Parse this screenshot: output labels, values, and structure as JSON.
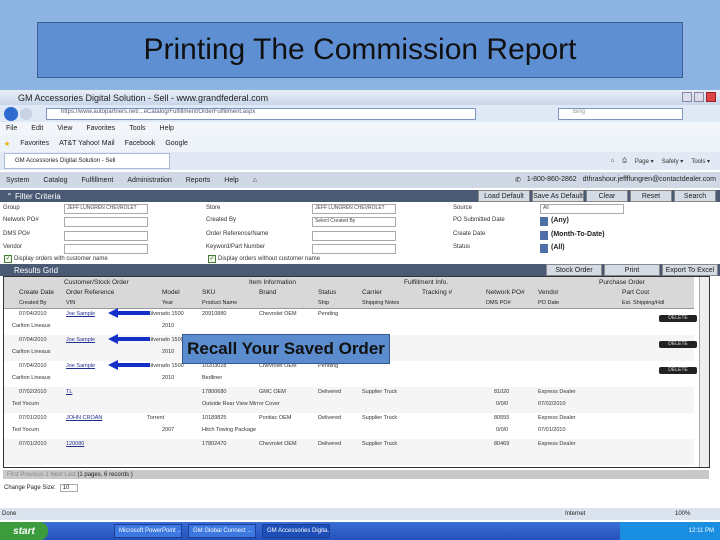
{
  "slide_title": "Printing The Commission Report",
  "callout": "Recall Your Saved Order",
  "browser": {
    "window_title": "GM Accessories Digital Solution - Sell - www.grandfederal.com",
    "url": "https://www.autopartners.net/...eCatalog/Fulfillment/OrderFulfillment.aspx",
    "search_placeholder": "Bing",
    "menu": [
      "File",
      "Edit",
      "View",
      "Favorites",
      "Tools",
      "Help"
    ],
    "favorites": [
      "Favorites",
      "AT&T Yahoo! Mail",
      "Facebook",
      "Google"
    ],
    "tab": "GM Accessories Digital Solution - Sell",
    "tools": [
      "Page ▾",
      "Safety ▾",
      "Tools ▾"
    ],
    "status": "Done",
    "zone": "Internet",
    "zoom": "100%"
  },
  "app": {
    "nav": [
      "System",
      "Catalog",
      "Fulfillment",
      "Administration",
      "Reports",
      "Help"
    ],
    "phone": "1-800-860-2862",
    "email": "dthrashour.jeffflungren@contactdealer.com",
    "filter": {
      "title": "Filter Criteria",
      "buttons": [
        "Load Default",
        "Save As Default",
        "Clear",
        "Reset",
        "Search"
      ],
      "group_label": "Group",
      "group_value": "JEFF LUNGREN CHEVROLET",
      "network_po_label": "Network PO#",
      "dms_po_label": "DMS PO#",
      "vendor_label": "Vendor",
      "store_label": "Store",
      "store_value": "JEFF LUNGREN CHEVROLET",
      "created_by_label": "Created By",
      "created_by_value": "Select Created By",
      "order_ref_label": "Order Reference/Name",
      "keyword_label": "Keyword/Part Number",
      "source_label": "Source",
      "source_value": "All",
      "po_date_label": "PO Submitted Date",
      "po_date_value": "(Any)",
      "create_date_label": "Create Date",
      "create_date_value": "(Month-To-Date)",
      "status_label": "Status",
      "status_value": "(All)",
      "chk_with": "Display orders with customer name",
      "chk_without": "Display orders without customer name"
    },
    "results": {
      "title": "Results Grid",
      "buttons": [
        "Stock Order",
        "Print",
        "Export To Excel"
      ],
      "groups": [
        "Customer/Stock Order",
        "Item Information",
        "Fulfillment Info.",
        "Purchase Order"
      ],
      "headers1": [
        "Create Date",
        "Order Reference",
        "Model",
        "SKU",
        "Brand",
        "Status",
        "Carrier",
        "Tracking #",
        "Network PO#",
        "Vendor",
        "Part Cost"
      ],
      "headers2": [
        "Created By",
        "VIN",
        "Year",
        "Product Name",
        "",
        "Ship",
        "Shipping Notes",
        "",
        "DMS PO#",
        "PO Date",
        "Est. Shipping/Hdl"
      ],
      "delete_label": "DELETE",
      "rows": [
        {
          "date": "07/04/2010",
          "by": "Carlton Lineaus",
          "ref": "Joe Sample",
          "model": "Silverado 1500",
          "year": "2010",
          "sku": "20910880",
          "product": "",
          "brand": "Chevrolet OEM",
          "status": "Pending",
          "carrier": "",
          "network_po": "",
          "dms_po": "",
          "vendor": "",
          "po_date": "",
          "deletable": true
        },
        {
          "date": "07/04/2010",
          "by": "Carlton Lineaus",
          "ref": "Joe Sample",
          "model": "Silverado 1500",
          "year": "2010",
          "sku": "",
          "product": "",
          "brand": "",
          "status": "",
          "carrier": "",
          "network_po": "",
          "dms_po": "",
          "vendor": "",
          "po_date": "",
          "deletable": true
        },
        {
          "date": "07/04/2010",
          "by": "Carlton Lineaus",
          "ref": "Joe Sample",
          "model": "Silverado 1500",
          "year": "2010",
          "sku": "10203028",
          "product": "Bedliner",
          "brand": "Chevrolet OEM",
          "status": "Pending",
          "carrier": "",
          "network_po": "",
          "dms_po": "",
          "vendor": "",
          "po_date": "",
          "deletable": true
        },
        {
          "date": "07/02/2010",
          "by": "Ted Yocum",
          "ref": "TL",
          "model": "",
          "year": "",
          "sku": "17800680",
          "product": "Outside Rear View Mirror Cover",
          "brand": "GMC OEM",
          "status": "Delivered",
          "carrier": "Supplier Truck",
          "network_po": "81020",
          "dms_po": "0/0/0",
          "vendor": "Express Dealer",
          "po_date": "07/02/2010",
          "deletable": false
        },
        {
          "date": "07/01/2010",
          "by": "Ted Yocum",
          "ref": "JOHN CROAN",
          "model": "Torrent",
          "year": "2007",
          "sku": "10189825",
          "product": "Hitch Towing Package",
          "brand": "Pontiac OEM",
          "status": "Delivered",
          "carrier": "Supplier Truck",
          "network_po": "80555",
          "dms_po": "0/0/0",
          "vendor": "Express Dealer",
          "po_date": "07/01/2010",
          "deletable": false
        },
        {
          "date": "07/01/2010",
          "by": "",
          "ref": "120080",
          "model": "",
          "year": "",
          "sku": "17802470",
          "product": "",
          "brand": "Chevrolet OEM",
          "status": "Delivered",
          "carrier": "Supplier Truck",
          "network_po": "80469",
          "dms_po": "",
          "vendor": "Express Dealer",
          "po_date": "",
          "deletable": false
        }
      ],
      "pager": "First Previous 1 Next Last",
      "pager_info": "(1 pages, 6 records )",
      "page_size_label": "Change Page Size:",
      "page_size_value": "10"
    }
  },
  "taskbar": {
    "start": "start",
    "items": [
      "Microsoft PowerPoint ...",
      "GM Global Connect ...",
      "GM Accessories Digita..."
    ],
    "clock": "12:11 PM"
  }
}
